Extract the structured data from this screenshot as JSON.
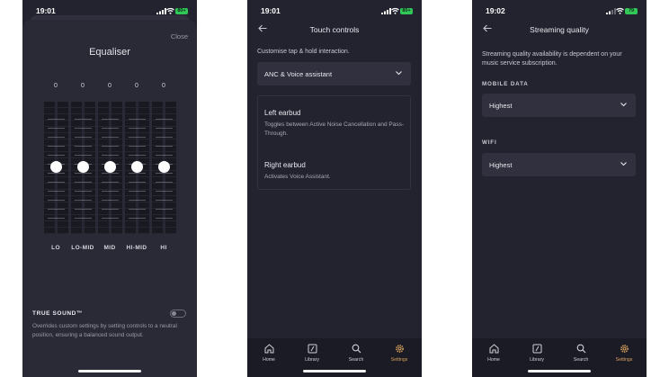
{
  "status": {
    "p1_time": "19:01",
    "p2_time": "19:01",
    "p3_time": "19:02",
    "p1_battery": "80+",
    "p2_battery": "80+",
    "p3_battery": "79"
  },
  "colors": {
    "accent": "#d9a15c",
    "background": "#232330",
    "card": "#30303e",
    "battery": "#32c759"
  },
  "equaliser": {
    "close": "Close",
    "title": "Equaliser",
    "bands": [
      {
        "label": "LO",
        "value": "0"
      },
      {
        "label": "LO-MID",
        "value": "0"
      },
      {
        "label": "MID",
        "value": "0"
      },
      {
        "label": "HI-MID",
        "value": "0"
      },
      {
        "label": "HI",
        "value": "0"
      }
    ],
    "true_sound": {
      "label": "TRUE SOUND™",
      "enabled": false,
      "description": "Overrides custom settings by setting controls to a neutral position, ensuring a balanced sound output."
    }
  },
  "touch_controls": {
    "title": "Touch controls",
    "subtitle": "Customise tap & hold interaction.",
    "dropdown_value": "ANC & Voice assistant",
    "left": {
      "label": "Left earbud",
      "desc": "Toggles between Active Noise Cancellation and Pass-Through."
    },
    "right": {
      "label": "Right earbud",
      "desc": "Activates Voice Assistant."
    }
  },
  "streaming": {
    "title": "Streaming quality",
    "note": "Streaming quality availability is dependent on your music service subscription.",
    "mobile_label": "MOBILE DATA",
    "mobile_value": "Highest",
    "wifi_label": "WIFI",
    "wifi_value": "Highest"
  },
  "tabs": [
    {
      "label": "Home",
      "icon": "home-icon"
    },
    {
      "label": "Library",
      "icon": "library-icon"
    },
    {
      "label": "Search",
      "icon": "search-icon"
    },
    {
      "label": "Settings",
      "icon": "gear-icon",
      "active": true
    }
  ]
}
